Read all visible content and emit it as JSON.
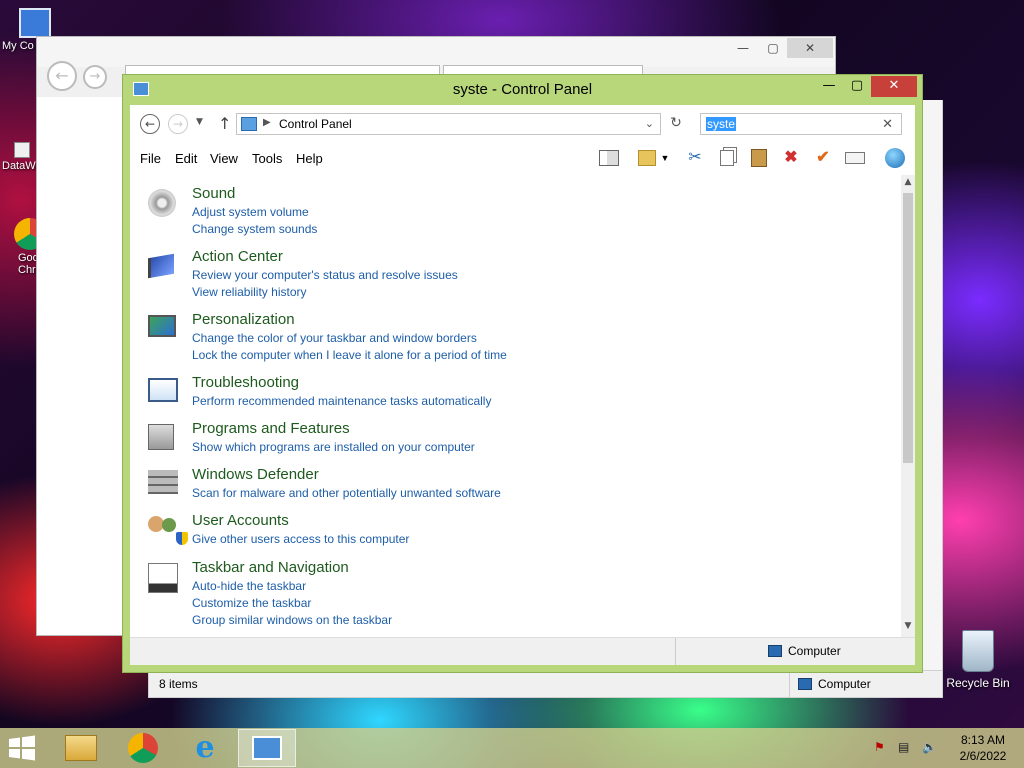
{
  "desktop": {
    "icons": [
      {
        "label": "My Co"
      },
      {
        "label": "DataW"
      },
      {
        "label": "Goo\nChr"
      }
    ],
    "recycle_bin": {
      "label": "Recycle Bin"
    }
  },
  "back_window": {
    "status_items": "8 items",
    "status_location": "Computer"
  },
  "window": {
    "title": "syste - Control Panel",
    "address": {
      "crumb": "Control Panel"
    },
    "search": {
      "value": "syste"
    },
    "menu": [
      "File",
      "Edit",
      "View",
      "Tools",
      "Help"
    ],
    "categories": [
      {
        "title": "Sound",
        "links": [
          "Adjust system volume",
          "Change system sounds"
        ]
      },
      {
        "title": "Action Center",
        "links": [
          "Review your computer's status and resolve issues",
          "View reliability history"
        ]
      },
      {
        "title": "Personalization",
        "links": [
          "Change the color of your taskbar and window borders",
          "Lock the computer when I leave it alone for a period of time"
        ]
      },
      {
        "title": "Troubleshooting",
        "links": [
          "Perform recommended maintenance tasks automatically"
        ]
      },
      {
        "title": "Programs and Features",
        "links": [
          "Show which programs are installed on your computer"
        ]
      },
      {
        "title": "Windows Defender",
        "links": [
          "Scan for malware and other potentially unwanted software"
        ]
      },
      {
        "title": "User Accounts",
        "links": [
          "Give other users access to this computer"
        ]
      },
      {
        "title": "Taskbar and Navigation",
        "links": [
          "Auto-hide the taskbar",
          "Customize the taskbar",
          "Group similar windows on the taskbar"
        ]
      }
    ],
    "status": {
      "location": "Computer"
    }
  },
  "taskbar": {
    "time": "8:13 AM",
    "date": "2/6/2022"
  },
  "colors": {
    "window_frame": "#b7d77a",
    "category_title": "#1e5a1e",
    "link": "#1e5ea8",
    "close_button": "#c7413a"
  }
}
